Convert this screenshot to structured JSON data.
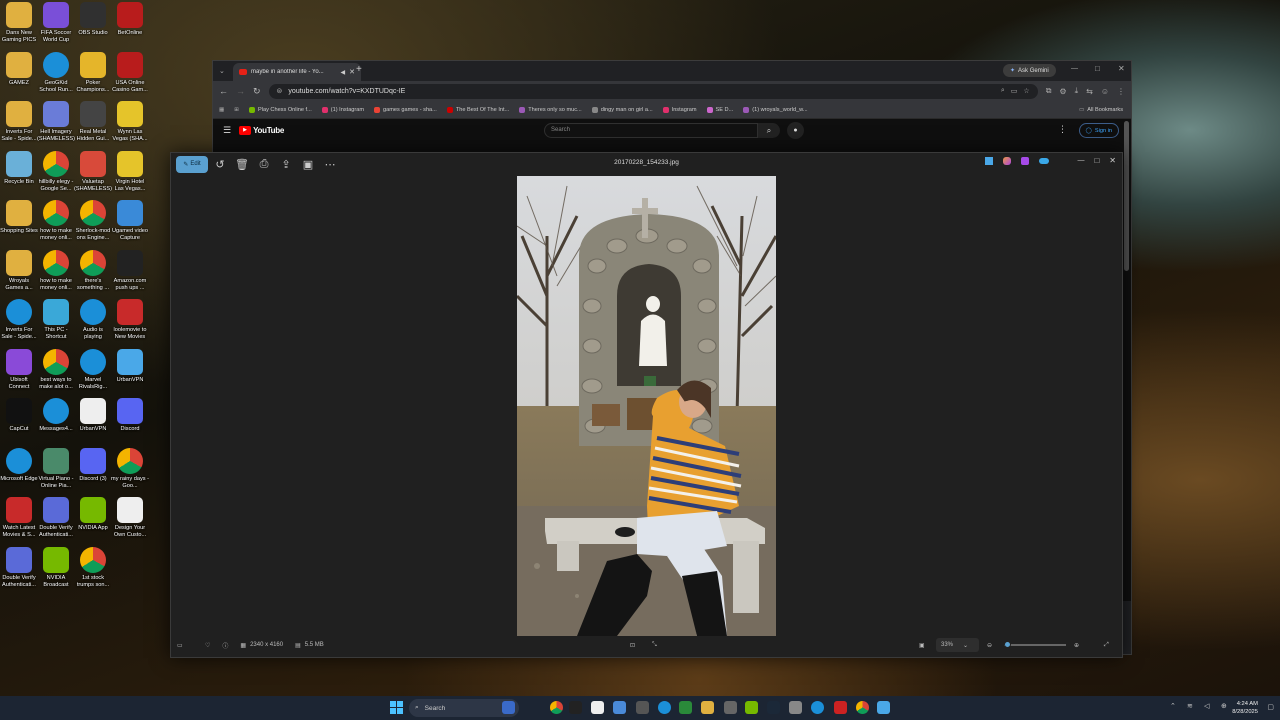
{
  "desktop_icons": [
    {
      "label": "Dans New Gaming PICS",
      "color": "#e0b040",
      "glyph": "folder-icon"
    },
    {
      "label": "FIFA Soccer World Cup",
      "color": "#7a4fd8",
      "glyph": "fifa-icon"
    },
    {
      "label": "OBS Studio",
      "color": "#303030",
      "glyph": "obs-icon"
    },
    {
      "label": "BetOnline",
      "color": "#b81c1c",
      "glyph": "betonline-icon"
    },
    {
      "label": "GAMEZ",
      "color": "#e0b040",
      "glyph": "folder-icon"
    },
    {
      "label": "GeoGKid School Run...",
      "color": "#1b8fd8",
      "glyph": "edge-icon"
    },
    {
      "label": "Poker Champions...",
      "color": "#e5b52a",
      "glyph": "poker-icon"
    },
    {
      "label": "USA Online Casino Gam...",
      "color": "#b81c1c",
      "glyph": "casino-icon"
    },
    {
      "label": "Inverts For Sale - Spide...",
      "color": "#e0b040",
      "glyph": "folder-icon"
    },
    {
      "label": "Hell Imagery (SHAMELESS)",
      "color": "#6a7cd8",
      "glyph": "image-icon"
    },
    {
      "label": "Real Metal Hidden Gui...",
      "color": "#444",
      "glyph": "metal-icon"
    },
    {
      "label": "Wynn Las Vegas (SHA...",
      "color": "#e5c42a",
      "glyph": "arrow-icon"
    },
    {
      "label": "Recycle Bin",
      "color": "#6ab0d8",
      "glyph": "recycle-icon"
    },
    {
      "label": "hillbilly elegy - Google Se...",
      "color": "#eee",
      "glyph": "chrome-icon"
    },
    {
      "label": "Valuetap (SHAMELESS)",
      "color": "#d84a3a",
      "glyph": "valuetap-icon"
    },
    {
      "label": "Virgin Hotel Las Vegas...",
      "color": "#e5c42a",
      "glyph": "arrow-icon"
    },
    {
      "label": "Shopping Sites",
      "color": "#e0b040",
      "glyph": "folder-icon"
    },
    {
      "label": "how to make money onli...",
      "color": "#eee",
      "glyph": "chrome-icon"
    },
    {
      "label": "Sherlock-mod ons Engine...",
      "color": "#eee",
      "glyph": "chrome-icon"
    },
    {
      "label": "Ugamed video Capture",
      "color": "#3a8ad8",
      "glyph": "video-icon"
    },
    {
      "label": "Wroyals Games a...",
      "color": "#e0b040",
      "glyph": "folder-icon"
    },
    {
      "label": "how to make money onli...",
      "color": "#eee",
      "glyph": "chrome-icon"
    },
    {
      "label": "there's something ...",
      "color": "#eee",
      "glyph": "chrome-icon"
    },
    {
      "label": "Amazon.com push ups ...",
      "color": "#222",
      "glyph": "amazon-icon"
    },
    {
      "label": "Inverts For Sale - Spide...",
      "color": "#1b8fd8",
      "glyph": "edge-icon"
    },
    {
      "label": "This PC - Shortcut",
      "color": "#3aa8d8",
      "glyph": "pc-icon"
    },
    {
      "label": "Audio is playing",
      "color": "#1b8fd8",
      "glyph": "edge-icon"
    },
    {
      "label": "loolemovie to New Movies",
      "color": "#c82a2a",
      "glyph": "lm-icon"
    },
    {
      "label": "Ubisoft Connect",
      "color": "#8a4ad8",
      "glyph": "ubisoft-icon"
    },
    {
      "label": "best ways to make alot o...",
      "color": "#eee",
      "glyph": "chrome-icon"
    },
    {
      "label": "Marvel RivalsRig...",
      "color": "#1b8fd8",
      "glyph": "edge-icon"
    },
    {
      "label": "UrbanVPN",
      "color": "#4aa8e8",
      "glyph": "vpn-icon"
    },
    {
      "label": "CapCut",
      "color": "#111",
      "glyph": "capcut-icon"
    },
    {
      "label": "Messages4...",
      "color": "#1b8fd8",
      "glyph": "edge-icon"
    },
    {
      "label": "UrbanVPN",
      "color": "#eee",
      "glyph": "file-icon"
    },
    {
      "label": "Discord",
      "color": "#5865f2",
      "glyph": "discord-icon"
    },
    {
      "label": "Microsoft Edge",
      "color": "#1b8fd8",
      "glyph": "edge-icon"
    },
    {
      "label": "Virtual Piano - Online Pia...",
      "color": "#4a8a6a",
      "glyph": "piano-icon"
    },
    {
      "label": "Discord (3)",
      "color": "#5865f2",
      "glyph": "discord-icon"
    },
    {
      "label": "my rainy days - Goo...",
      "color": "#eee",
      "glyph": "chrome-icon"
    },
    {
      "label": "Watch Latest Movies & S...",
      "color": "#c82a2a",
      "glyph": "lm-icon"
    },
    {
      "label": "Double Verify Authenticati...",
      "color": "#5a6ad8",
      "glyph": "shield-icon"
    },
    {
      "label": "NVIDIA App",
      "color": "#76b900",
      "glyph": "nvidia-icon"
    },
    {
      "label": "Design Your Own Custo...",
      "color": "#eee",
      "glyph": "design-icon"
    },
    {
      "label": "Double Verify Authenticati...",
      "color": "#5a6ad8",
      "glyph": "shield-icon"
    },
    {
      "label": "NVIDIA Broadcast",
      "color": "#76b900",
      "glyph": "nvidia-icon"
    },
    {
      "label": "1st stock trumps son...",
      "color": "#eee",
      "glyph": "chrome-icon"
    }
  ],
  "chrome": {
    "tab_title": "maybe in another life - Yo...",
    "url": "youtube.com/watch?v=KXDTUDqc-IE",
    "ask_gemini": "Ask Gemini",
    "bookmarks": [
      "Play Chess Online f...",
      "(1) Instagram",
      "games games - sha...",
      "The Best Of The Int...",
      "Theres only so muc...",
      "dingy man on girl a...",
      "Instagram",
      "SE D...",
      "(1) wroyals_world_w..."
    ],
    "all_bookmarks": "All Bookmarks",
    "youtube": {
      "logo_text": "YouTube",
      "search_placeholder": "Search",
      "sign_in": "Sign in"
    }
  },
  "photos": {
    "title": "20170228_154233.jpg",
    "edit_label": "Edit",
    "dimensions": "2340 x 4160",
    "file_size": "5.5 MB",
    "zoom": "33%",
    "zoom_fraction": 0.05
  },
  "taskbar": {
    "search_label": "Search",
    "time": "4:24 AM",
    "date": "8/28/2025"
  }
}
